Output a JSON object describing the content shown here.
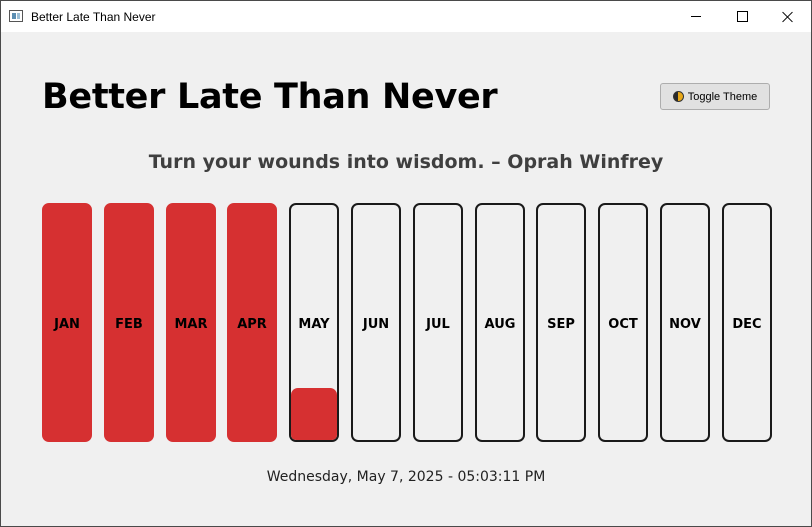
{
  "window": {
    "title": "Better Late Than Never"
  },
  "header": {
    "title": "Better Late Than Never",
    "toggle_label": "Toggle Theme",
    "toggle_icon": "theme-toggle-icon"
  },
  "quote": "Turn your wounds into wisdom. – Oprah Winfrey",
  "progress_color": "#d63031",
  "months": [
    {
      "label": "JAN",
      "progress": 1.0
    },
    {
      "label": "FEB",
      "progress": 1.0
    },
    {
      "label": "MAR",
      "progress": 1.0
    },
    {
      "label": "APR",
      "progress": 1.0
    },
    {
      "label": "MAY",
      "progress": 0.22
    },
    {
      "label": "JUN",
      "progress": 0
    },
    {
      "label": "JUL",
      "progress": 0
    },
    {
      "label": "AUG",
      "progress": 0
    },
    {
      "label": "SEP",
      "progress": 0
    },
    {
      "label": "OCT",
      "progress": 0
    },
    {
      "label": "NOV",
      "progress": 0
    },
    {
      "label": "DEC",
      "progress": 0
    }
  ],
  "datetime": "Wednesday, May 7, 2025 - 05:03:11 PM"
}
